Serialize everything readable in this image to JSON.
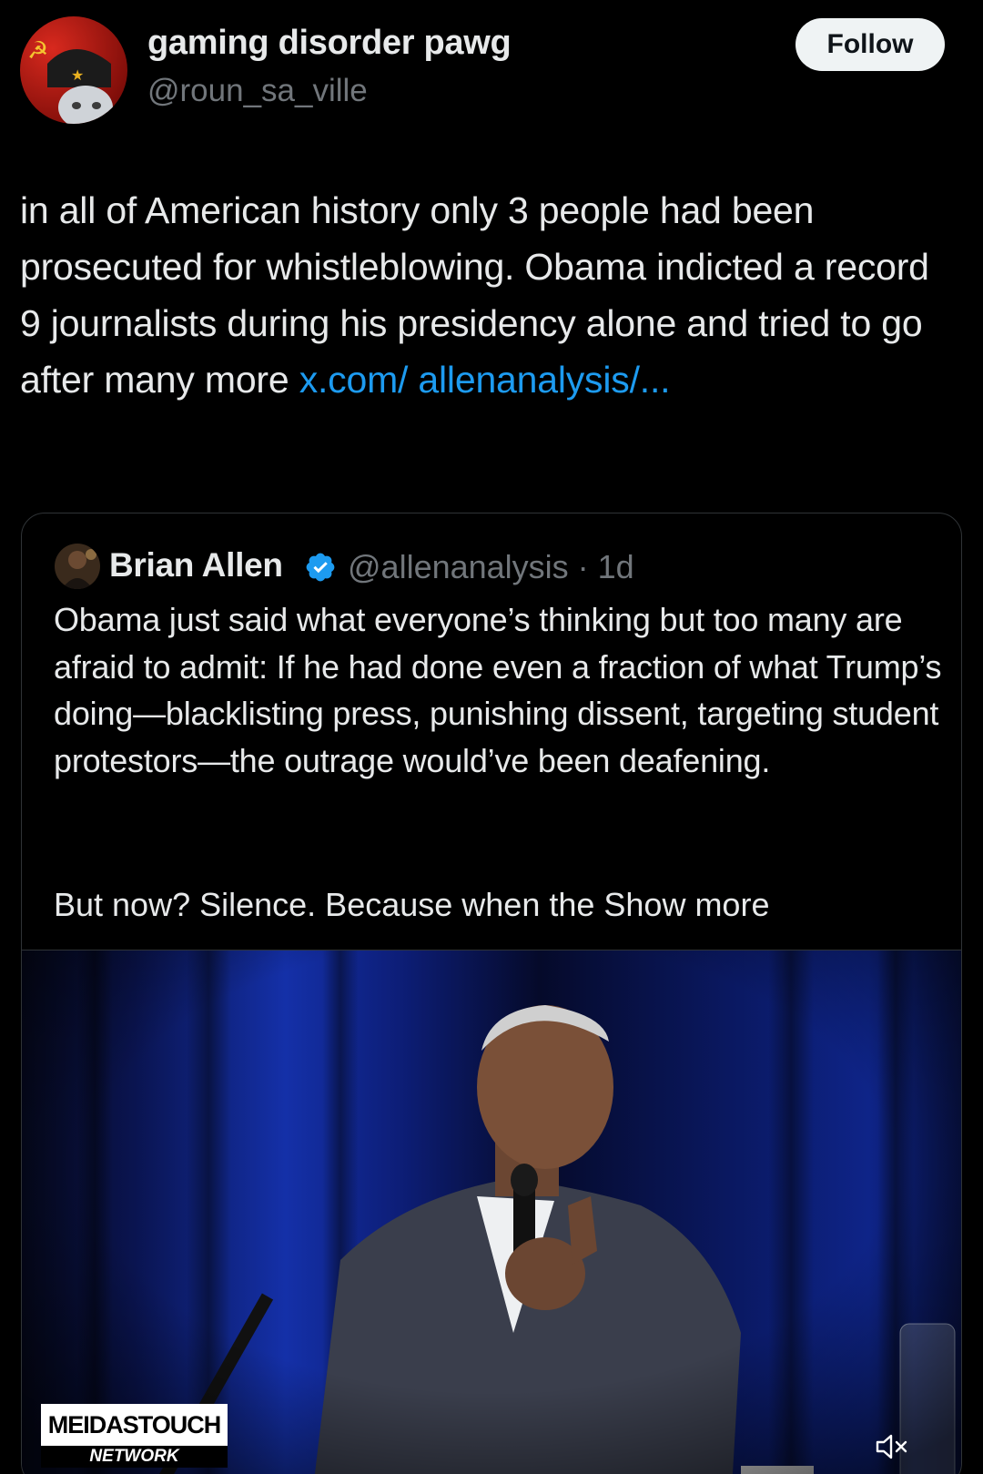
{
  "post": {
    "author": {
      "display_name": "gaming disorder pawg",
      "handle": "@roun_sa_ville"
    },
    "follow_label": "Follow",
    "text": "in all of American history only 3 people had been prosecuted for whistleblowing. Obama indicted a record 9 journalists during his presidency alone and tried to go after many more ",
    "link_text": "x.com/ allenanalysis/..."
  },
  "quote": {
    "display_name": "Brian Allen",
    "handle_time": "@allenanalysis · 1d",
    "text": "Obama just said what everyone’s thinking but too many are afraid to admit: If he had done even a fraction of what Trump’s doing—blacklisting press, punishing dissent, targeting student protestors—the outrage would’ve been deafening.",
    "text2": "But now? Silence. Because when the ",
    "show_more": "Show more",
    "video": {
      "watermark_top": "MEIDASTOUCH",
      "watermark_bottom": "NETWORK"
    }
  },
  "icons": {
    "verified": "verified-badge-icon",
    "mute": "muted-speaker-icon"
  },
  "colors": {
    "background": "#000000",
    "text": "#e7e9ea",
    "secondary_text": "#71767b",
    "link": "#1d9bf0",
    "verified": "#1d9bf0",
    "border": "#2f3336",
    "follow_button_bg": "#eff3f4"
  }
}
